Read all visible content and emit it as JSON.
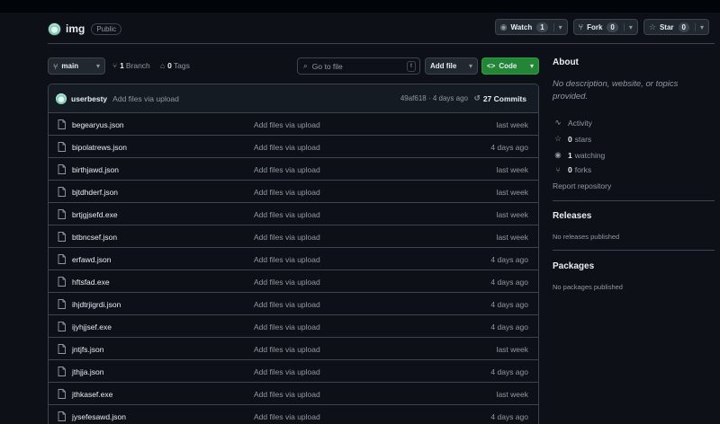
{
  "repo": {
    "name": "img",
    "visibility": "Public",
    "watch_label": "Watch",
    "watch_count": "1",
    "fork_label": "Fork",
    "fork_count": "0",
    "star_label": "Star",
    "star_count": "0"
  },
  "toolbar": {
    "branch": "main",
    "branches_count": "1",
    "branches_label": "Branch",
    "tags_count": "0",
    "tags_label": "Tags",
    "search_placeholder": "Go to file",
    "search_shortcut": "t",
    "add_file_label": "Add file",
    "code_label": "Code"
  },
  "commit": {
    "author": "userbesty",
    "message": "Add files via upload",
    "meta": "49af618 · 4 days ago",
    "commits_label": "27 Commits"
  },
  "files": [
    {
      "name": "begearyus.json",
      "message": "Add files via upload",
      "date": "last week"
    },
    {
      "name": "bipolatrews.json",
      "message": "Add files via upload",
      "date": "4 days ago"
    },
    {
      "name": "birthjawd.json",
      "message": "Add files via upload",
      "date": "last week"
    },
    {
      "name": "bjtdhderf.json",
      "message": "Add files via upload",
      "date": "last week"
    },
    {
      "name": "brtjgjsefd.exe",
      "message": "Add files via upload",
      "date": "last week"
    },
    {
      "name": "btbncsef.json",
      "message": "Add files via upload",
      "date": "last week"
    },
    {
      "name": "erfawd.json",
      "message": "Add files via upload",
      "date": "4 days ago"
    },
    {
      "name": "hftsfad.exe",
      "message": "Add files via upload",
      "date": "4 days ago"
    },
    {
      "name": "ihjdtrjigrdi.json",
      "message": "Add files via upload",
      "date": "4 days ago"
    },
    {
      "name": "ijyhjjsef.exe",
      "message": "Add files via upload",
      "date": "4 days ago"
    },
    {
      "name": "jntjfs.json",
      "message": "Add files via upload",
      "date": "last week"
    },
    {
      "name": "jthjja.json",
      "message": "Add files via upload",
      "date": "4 days ago"
    },
    {
      "name": "jthkasef.exe",
      "message": "Add files via upload",
      "date": "last week"
    },
    {
      "name": "jysefesawd.json",
      "message": "Add files via upload",
      "date": "4 days ago"
    }
  ],
  "about": {
    "title": "About",
    "description": "No description, website, or topics provided.",
    "activity_label": "Activity",
    "stars_count": "0",
    "stars_label": "stars",
    "watching_count": "1",
    "watching_label": "watching",
    "forks_count": "0",
    "forks_label": "forks",
    "report_label": "Report repository"
  },
  "releases": {
    "title": "Releases",
    "empty_text": "No releases published"
  },
  "packages": {
    "title": "Packages",
    "empty_text": "No packages published"
  },
  "colors": {
    "accent_green": "#238636",
    "background": "#0d1117",
    "border": "#3d444d",
    "muted": "#9198a1"
  }
}
